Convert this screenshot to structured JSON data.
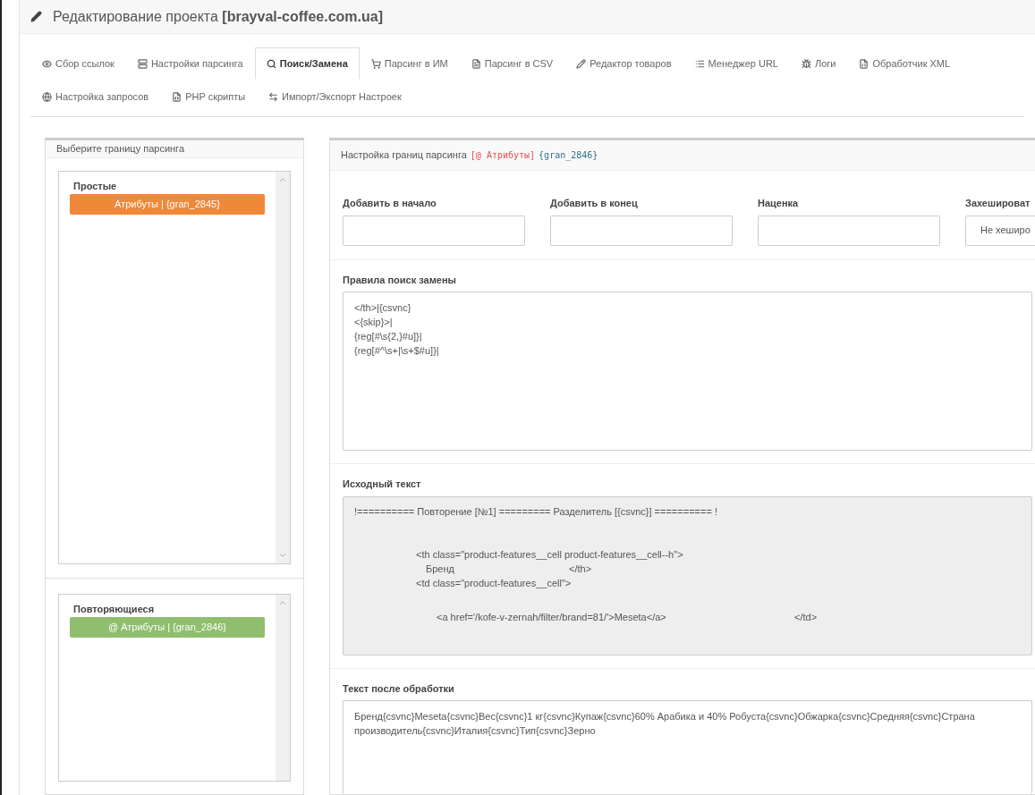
{
  "title": "Редактирование проекта **[brayval-coffee.com.ua]**",
  "tab_rows": [
    [
      {
        "label": "Сбор ссылок",
        "selected": false
      },
      {
        "label": "Настройки парсинга",
        "selected": false
      },
      {
        "label": "Поиск/Замена",
        "selected": true
      },
      {
        "label": "Парсинг в ИМ",
        "selected": false
      },
      {
        "label": "Парсинг в CSV",
        "selected": false
      },
      {
        "label": "Редактор товаров",
        "selected": false
      },
      {
        "label": "Менеджер URL",
        "selected": false
      },
      {
        "label": "Логи",
        "selected": false
      },
      {
        "label": "Обработчик XML",
        "selected": false
      }
    ],
    [
      {
        "label": "Настройка запросов",
        "selected": false
      },
      {
        "label": "PHP скрипты",
        "selected": false
      },
      {
        "label": "Импорт/Экспорт Настроек",
        "selected": false
      }
    ]
  ],
  "left_panel": {
    "title": "Выберите границу парсинга",
    "groups": [
      {
        "title": "Простые",
        "items": [
          {
            "label": "Атрибуты | {gran_2845}",
            "color": "#f0883a"
          }
        ]
      },
      {
        "title": "Повторяющиеся",
        "items": [
          {
            "label": "@ Атрибуты | {gran_2846}",
            "color": "#8fbe6c"
          }
        ]
      }
    ]
  },
  "right_panel": {
    "header": {
      "text": "Настройка границ парсинга",
      "tag": "[@ Атрибуты]",
      "code": "{gran_2846}"
    },
    "fields": [
      {
        "kind": "input",
        "label": "Добавить в начало"
      },
      {
        "kind": "input",
        "label": "Добавить в конец"
      },
      {
        "kind": "input",
        "label": "Наценка"
      },
      {
        "kind": "select",
        "label": "Захешироват",
        "value": "Не хеширо"
      }
    ],
    "rules": {
      "label": "Правила поиск замены",
      "lines": [
        "</th>|{csvnc}",
        "<{skip}>|",
        "{reg[#\\s{2,}#u]}|",
        "{reg[#^\\s+|\\s+$#u]}|"
      ]
    },
    "source": {
      "label": "Исходный текст",
      "lines": [
        {
          "text": "!========== Повторение [№1] ========= Разделитель [{csvnc}] ========== !"
        },
        {
          "text": "<th class=\"product-features__cell product-features__cell--h\">"
        },
        {
          "text": "Бренд",
          "tail": "</th>"
        },
        {
          "text": "<td class=\"product-features__cell\">"
        },
        {
          "text": "<a href='/kofe-v-zernah/filter/brand=81/'>Meseta</a>",
          "tail": "</td>"
        }
      ]
    },
    "result": {
      "label": "Текст после обработки",
      "value": "Бренд{csvnc}Meseta{csvnc}Вес{csvnc}1 кг{csvnc}Купаж{csvnc}60% Арабика и 40% Робуста{csvnc}Обжарка{csvnc}Средняя{csvnc}Страна производитель{csvnc}Италия{csvnc}Тип{csvnc}Зерно"
    }
  }
}
